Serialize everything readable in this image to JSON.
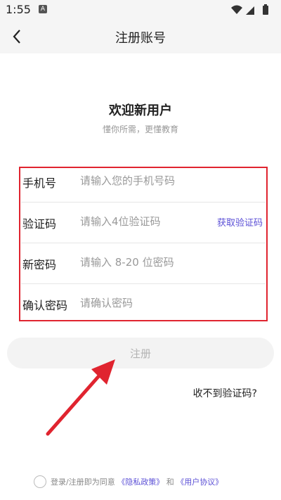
{
  "status": {
    "time": "1:55",
    "notification_glyph": "A"
  },
  "nav": {
    "title": "注册账号"
  },
  "welcome": {
    "title": "欢迎新用户",
    "subtitle": "懂你所需，更懂教育"
  },
  "form": {
    "phone": {
      "label": "手机号",
      "placeholder": "请输入您的手机号码"
    },
    "code": {
      "label": "验证码",
      "placeholder": "请输入4位验证码",
      "action": "获取验证码"
    },
    "password": {
      "label": "新密码",
      "placeholder": "请输入 8-20 位密码"
    },
    "confirm": {
      "label": "确认密码",
      "placeholder": "请确认密码"
    }
  },
  "register_button": "注册",
  "no_code_link": "收不到验证码?",
  "agreement": {
    "prefix": "登录/注册即为同意",
    "privacy": "《隐私政策》",
    "and": "和",
    "user_agreement": "《用户协议》"
  },
  "colors": {
    "accent": "#5b4fd6",
    "annotation": "#e0242f"
  }
}
